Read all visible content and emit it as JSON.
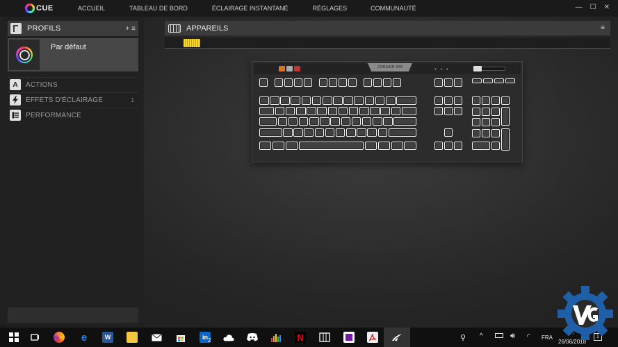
{
  "app": {
    "logo_text": "CUE"
  },
  "nav": {
    "items": [
      {
        "label": "ACCUEIL"
      },
      {
        "label": "TABLEAU DE BORD"
      },
      {
        "label": "ÉCLAIRAGE INSTANTANÉ"
      },
      {
        "label": "RÉGLAGES"
      },
      {
        "label": "COMMUNAUTÉ"
      }
    ]
  },
  "window": {
    "minimize": "—",
    "maximize": "☐",
    "close": "✕"
  },
  "profiles": {
    "title": "PROFILS",
    "add": "+",
    "menu": "≡",
    "active_profile": "Par défaut"
  },
  "menu": {
    "actions": {
      "label": "ACTIONS",
      "icon": "A"
    },
    "lighting": {
      "label": "EFFETS D'ÉCLAIRAGE",
      "count": "1",
      "icon": "lightning-icon"
    },
    "performance": {
      "label": "PERFORMANCE",
      "icon": "sliders-icon"
    }
  },
  "devices": {
    "title": "APPAREILS",
    "menu": "≡",
    "keyboard_brand": "CORSAIR K68"
  },
  "taskbar": {
    "linkedin_badge": "2",
    "language": "FRA",
    "time": "7:",
    "date": "26/06/2018",
    "notification_count": "1"
  },
  "colors": {
    "accent_yellow": "#f4d63a",
    "background": "#262626",
    "panel_header": "#3c3c3c"
  }
}
